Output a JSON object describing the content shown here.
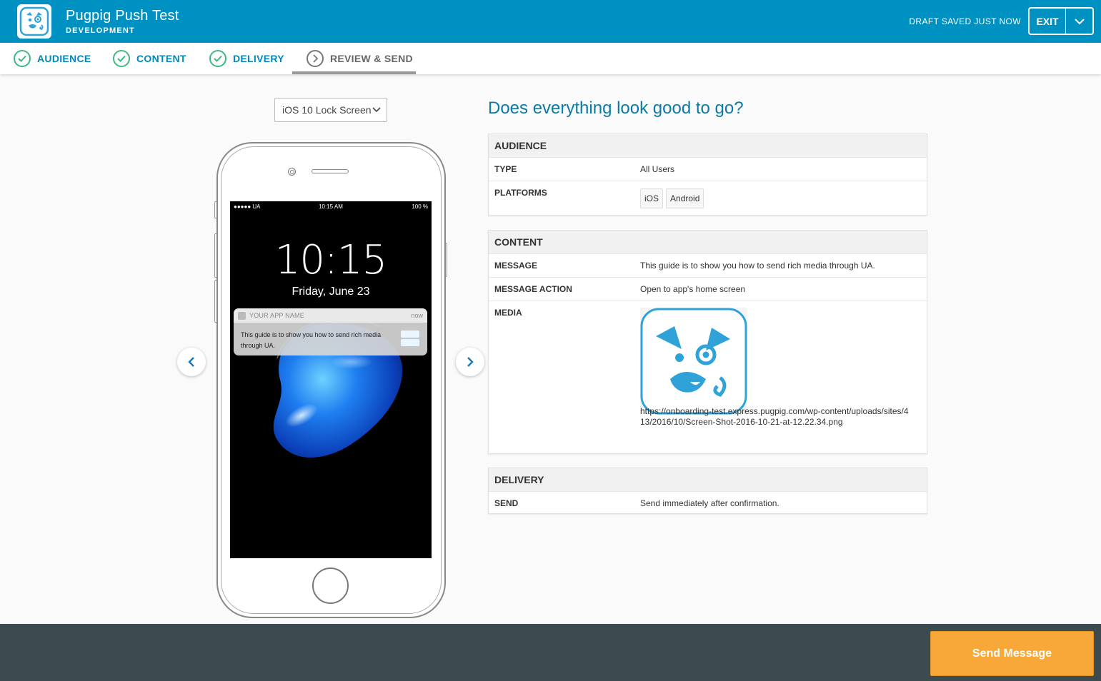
{
  "header": {
    "app_title": "Pugpig Push Test",
    "environment": "DEVELOPMENT",
    "draft_status": "DRAFT SAVED JUST NOW",
    "exit_label": "EXIT",
    "bg_color": "#0091c3"
  },
  "steps": [
    {
      "label": "AUDIENCE",
      "state": "done",
      "icon": "check-circle-icon"
    },
    {
      "label": "CONTENT",
      "state": "done",
      "icon": "check-circle-icon"
    },
    {
      "label": "DELIVERY",
      "state": "done",
      "icon": "check-circle-icon"
    },
    {
      "label": "REVIEW & SEND",
      "state": "current",
      "icon": "chevron-right-circle-icon"
    }
  ],
  "preview": {
    "device_selected": "iOS 10 Lock Screen",
    "status_left": "●●●●● UA",
    "status_time": "10:15 AM",
    "status_right": "100 %",
    "lock_time": "10:15",
    "lock_date": "Friday, June 23",
    "notif_app": "YOUR APP NAME",
    "notif_time": "now",
    "notif_text": "This guide is to show you how to send rich media through UA."
  },
  "summary": {
    "heading": "Does everything look good to go?",
    "audience": {
      "title": "AUDIENCE",
      "type_label": "TYPE",
      "type_value": "All Users",
      "platforms_label": "PLATFORMS",
      "platforms": [
        "iOS",
        "Android"
      ]
    },
    "content": {
      "title": "CONTENT",
      "message_label": "MESSAGE",
      "message_value": "This guide is to show you how to send rich media through UA.",
      "action_label": "MESSAGE ACTION",
      "action_value": "Open to app's home screen",
      "media_label": "MEDIA",
      "media_url": "https://onboarding-test.express.pugpig.com/wp-content/uploads/sites/413/2016/10/Screen-Shot-2016-10-21-at-12.22.34.png"
    },
    "delivery": {
      "title": "DELIVERY",
      "send_label": "SEND",
      "send_value": "Send immediately after confirmation."
    }
  },
  "footer": {
    "send_label": "Send Message",
    "accent": "#f7a839"
  }
}
